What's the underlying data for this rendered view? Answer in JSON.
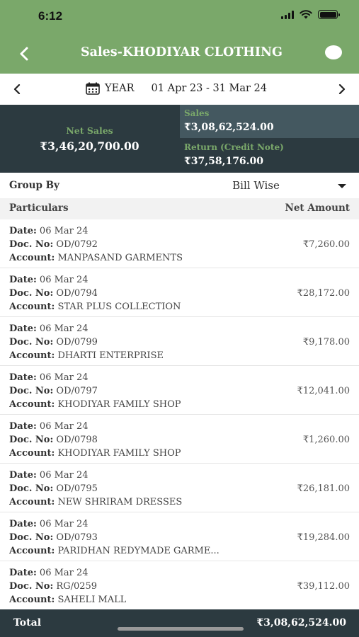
{
  "status_bar": {
    "time": "6:12"
  },
  "header": {
    "title": "Sales-KHODIYAR CLOTHING"
  },
  "period": {
    "type": "YEAR",
    "range": "01 Apr 23 - 31 Mar 24"
  },
  "summary": {
    "net_label": "Net Sales",
    "net_value": "₹3,46,20,700.00",
    "sales_label": "Sales",
    "sales_value": "₹3,08,62,524.00",
    "return_label": "Return (Credit Note)",
    "return_value": "₹37,58,176.00"
  },
  "group": {
    "label": "Group By",
    "value": "Bill Wise"
  },
  "table": {
    "col_particulars": "Particulars",
    "col_amount": "Net Amount",
    "label_date": "Date:",
    "label_doc": "Doc. No:",
    "label_account": "Account:",
    "rows": [
      {
        "date": "06 Mar 24",
        "doc": "OD/0792",
        "account": "MANPASAND GARMENTS",
        "amount": "₹7,260.00"
      },
      {
        "date": "06 Mar 24",
        "doc": "OD/0794",
        "account": "STAR PLUS COLLECTION",
        "amount": "₹28,172.00"
      },
      {
        "date": "06 Mar 24",
        "doc": "OD/0799",
        "account": "DHARTI ENTERPRISE",
        "amount": "₹9,178.00"
      },
      {
        "date": "06 Mar 24",
        "doc": "OD/0797",
        "account": "KHODIYAR FAMILY SHOP",
        "amount": "₹12,041.00"
      },
      {
        "date": "06 Mar 24",
        "doc": "OD/0798",
        "account": "KHODIYAR FAMILY SHOP",
        "amount": "₹1,260.00"
      },
      {
        "date": "06 Mar 24",
        "doc": "OD/0795",
        "account": "NEW SHRIRAM DRESSES",
        "amount": "₹26,181.00"
      },
      {
        "date": "06 Mar 24",
        "doc": "OD/0793",
        "account": "PARIDHAN REDYMADE GARME...",
        "amount": "₹19,284.00"
      },
      {
        "date": "06 Mar 24",
        "doc": "RG/0259",
        "account": "SAHELI MALL",
        "amount": "₹39,112.00"
      }
    ]
  },
  "total": {
    "label": "Total",
    "value": "₹3,08,62,524.00"
  },
  "colors": {
    "accent": "#7aa86a",
    "dark": "#2c3a40",
    "sales_box": "#445860"
  }
}
